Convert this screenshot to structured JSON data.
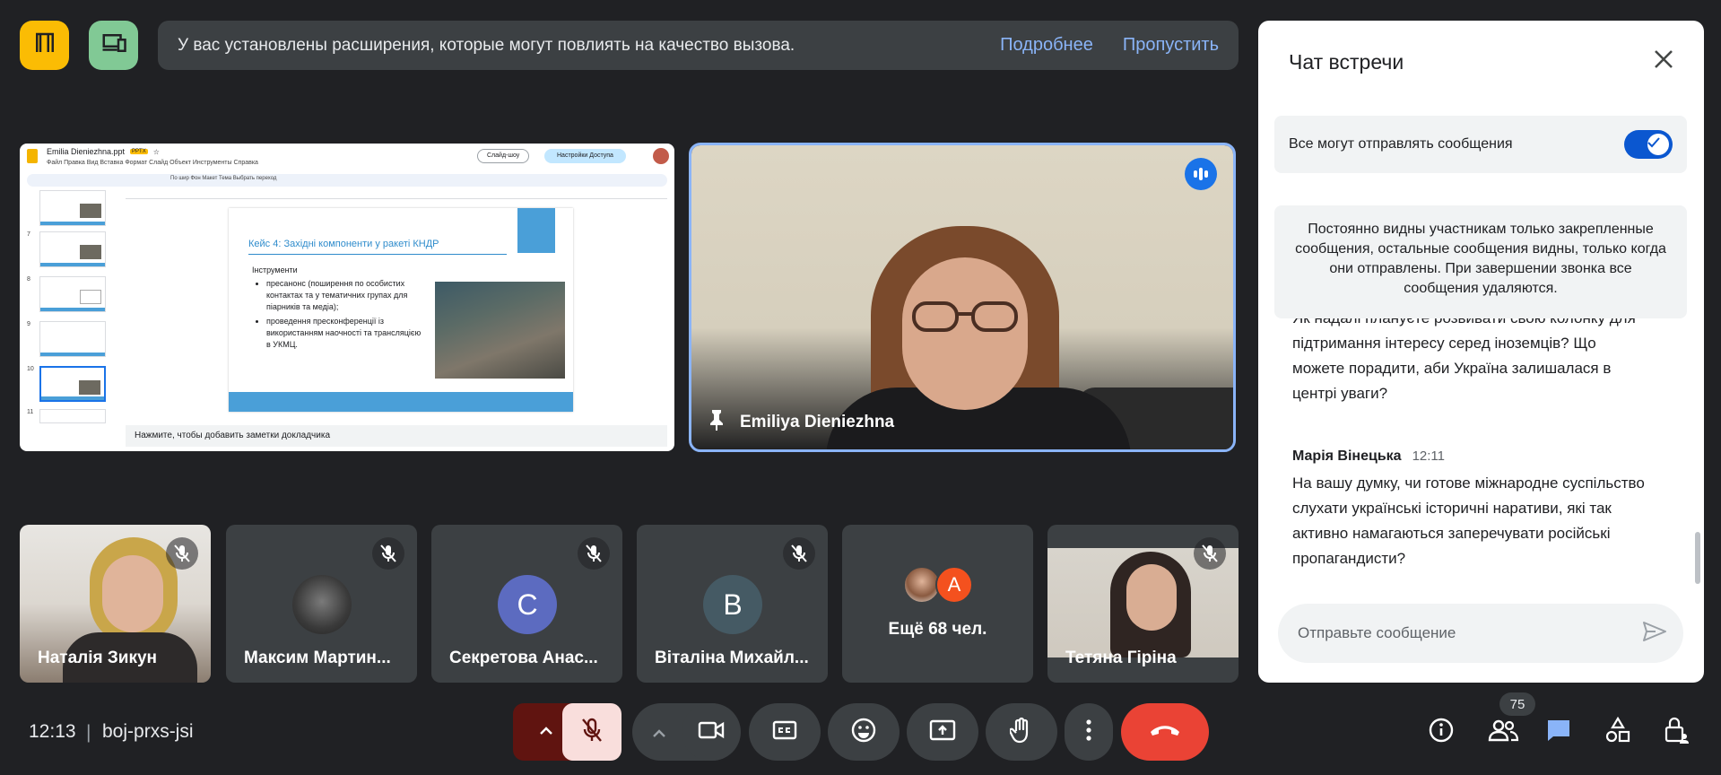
{
  "banner": {
    "message": "У вас установлены расширения, которые могут повлиять на качество вызова.",
    "more_link": "Подробнее",
    "skip_link": "Пропустить"
  },
  "presentation": {
    "file_title": "Emilia Dieniezhna.ppt",
    "file_badge": "PPTX",
    "menu": "Файл  Правка  Вид  Вставка  Формат  Слайд  Объект  Инструменты  Справка",
    "slideshow_btn": "Слайд-шоу",
    "share_btn": "Настройки Доступа",
    "toolbar": "По шир   Фон   Макет   Тема   Выбрать переход",
    "thumb_numbers": [
      "7",
      "8",
      "9",
      "10",
      "11"
    ],
    "slide_title": "Кейс 4: Західні компоненти у ракеті КНДР",
    "slide_subtitle": "Інструменти",
    "bullets": [
      "пресанонс (поширення по особистих контактах та у тематичних групах для піарників та медіа);",
      "проведення пресконференції із використанням наочності та трансляцією в УКМЦ."
    ],
    "notes_placeholder": "Нажмите, чтобы добавить заметки докладчика"
  },
  "main_video": {
    "name": "Emiliya Dieniezhna"
  },
  "tiles": [
    {
      "name": "Наталія Зикун",
      "type": "video"
    },
    {
      "name": "Максим Мартин...",
      "type": "photo"
    },
    {
      "name": "Секретова Анас...",
      "type": "letter",
      "letter": "С",
      "color": "#5c6bc0"
    },
    {
      "name": "Віталіна Михайл...",
      "type": "letter",
      "letter": "В",
      "color": "#455a64"
    },
    {
      "name": "Ещё 68 чел.",
      "type": "more",
      "letter": "А",
      "color": "#f4511e"
    },
    {
      "name": "Тетяна Гіріна",
      "type": "video"
    }
  ],
  "chat": {
    "title": "Чат встречи",
    "toggle_label": "Все могут отправлять сообщения",
    "info": "Постоянно видны участникам только закрепленные сообщения, остальные сообщения видны, только когда они отправлены. При завершении звонка все сообщения удаляются.",
    "message1": "Як надалі плануєте розвивати свою колонку для підтримання інтересу серед іноземців? Що можете порадити, аби Україна залишалася в центрі уваги?",
    "sender": "Марія Вінецька",
    "time": "12:11",
    "message2": "На вашу думку, чи готове міжнародне суспільство слухати українські історичні наративи, які так активно намагаються заперечувати російські пропагандисти?",
    "input_placeholder": "Отправьте сообщение"
  },
  "bottom": {
    "clock": "12:13",
    "separator": "|",
    "meeting_code": "boj-prxs-jsi",
    "participants_count": "75"
  },
  "colors": {
    "accent": "#8ab4f8",
    "end_call": "#ea4335",
    "mic_muted_bg": "#f9dedc",
    "mic_caret_bg": "#601410"
  }
}
